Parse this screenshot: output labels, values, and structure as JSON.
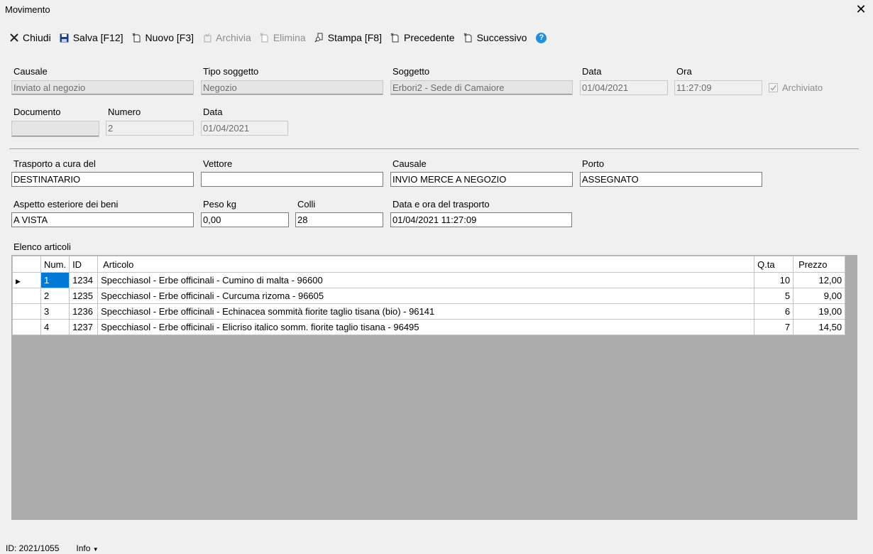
{
  "window": {
    "title": "Movimento"
  },
  "toolbar": {
    "chiudi": "Chiudi",
    "salva": "Salva [F12]",
    "nuovo": "Nuovo [F3]",
    "archivia": "Archivia",
    "elimina": "Elimina",
    "stampa": "Stampa [F8]",
    "precedente": "Precedente",
    "successivo": "Successivo",
    "help": "?"
  },
  "header": {
    "causale_label": "Causale",
    "causale_value": "Inviato al negozio",
    "tipo_soggetto_label": "Tipo soggetto",
    "tipo_soggetto_value": "Negozio",
    "soggetto_label": "Soggetto",
    "soggetto_value": "Erbori2  - Sede di Camaiore",
    "data_label": "Data",
    "data_value": "01/04/2021",
    "ora_label": "Ora",
    "ora_value": "11:27:09",
    "archiviato_label": "Archiviato",
    "documento_label": "Documento",
    "documento_value": "",
    "numero_label": "Numero",
    "numero_value": "2",
    "doc_data_label": "Data",
    "doc_data_value": "01/04/2021"
  },
  "transport": {
    "trasporto_label": "Trasporto a cura del",
    "trasporto_value": "DESTINATARIO",
    "vettore_label": "Vettore",
    "vettore_value": "",
    "causale_label": "Causale",
    "causale_value": "INVIO MERCE A NEGOZIO",
    "porto_label": "Porto",
    "porto_value": "ASSEGNATO",
    "aspetto_label": "Aspetto esteriore dei beni",
    "aspetto_value": "A VISTA",
    "peso_label": "Peso kg",
    "peso_value": "0,00",
    "colli_label": "Colli",
    "colli_value": "28",
    "data_trasporto_label": "Data e ora del trasporto",
    "data_trasporto_value": "01/04/2021 11:27:09"
  },
  "articles": {
    "label": "Elenco articoli",
    "columns": [
      "Num.",
      "ID",
      "Articolo",
      "Q.ta",
      "Prezzo"
    ],
    "rows": [
      {
        "num": "1",
        "id": "1234",
        "articolo": "Specchiasol - Erbe officinali - Cumino di malta - 96600",
        "qta": "10",
        "prezzo": "12,00"
      },
      {
        "num": "2",
        "id": "1235",
        "articolo": "Specchiasol - Erbe officinali - Curcuma rizoma - 96605",
        "qta": "5",
        "prezzo": "9,00"
      },
      {
        "num": "3",
        "id": "1236",
        "articolo": "Specchiasol - Erbe officinali - Echinacea sommità fiorite taglio tisana (bio) - 96141",
        "qta": "6",
        "prezzo": "19,00"
      },
      {
        "num": "4",
        "id": "1237",
        "articolo": "Specchiasol - Erbe officinali - Elicriso italico somm. fiorite taglio tisana - 96495",
        "qta": "7",
        "prezzo": "14,50"
      }
    ]
  },
  "status": {
    "id": "ID: 2021/1055",
    "info": "Info"
  },
  "colors": {
    "selection": "#0078d7",
    "help": "#1e90e0",
    "grid_bg": "#ababab"
  }
}
